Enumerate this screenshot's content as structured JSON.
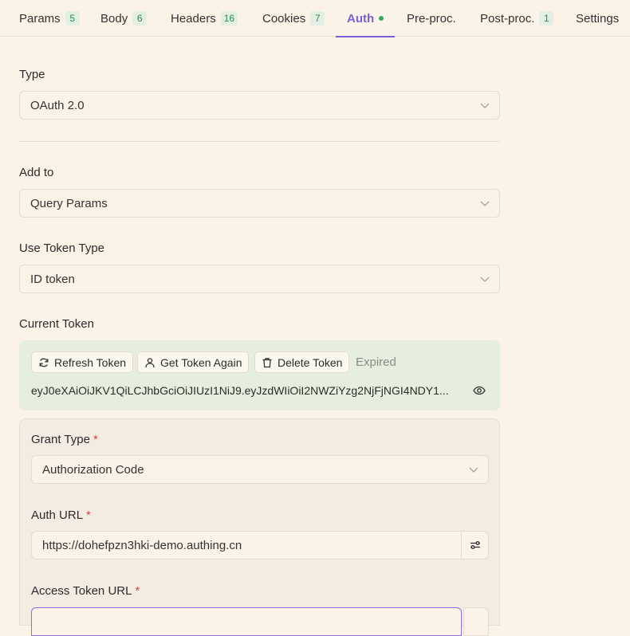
{
  "tabs": [
    {
      "label": "Params",
      "badge": "5"
    },
    {
      "label": "Body",
      "badge": "6"
    },
    {
      "label": "Headers",
      "badge": "16"
    },
    {
      "label": "Cookies",
      "badge": "7"
    },
    {
      "label": "Auth",
      "badge": ""
    },
    {
      "label": "Pre-proc.",
      "badge": ""
    },
    {
      "label": "Post-proc.",
      "badge": "1"
    },
    {
      "label": "Settings",
      "badge": ""
    }
  ],
  "active_tab": "Auth",
  "auth": {
    "type_label": "Type",
    "type_value": "OAuth 2.0",
    "add_to_label": "Add to",
    "add_to_value": "Query Params",
    "token_type_label": "Use Token Type",
    "token_type_value": "ID token",
    "current_token_label": "Current Token",
    "refresh_label": "Refresh Token",
    "get_again_label": "Get Token Again",
    "delete_label": "Delete Token",
    "status": "Expired",
    "token_value": "eyJ0eXAiOiJKV1QiLCJhbGciOiJIUzI1NiJ9.eyJzdWIiOiI2NWZiYzg2NjFjNGI4NDY1...",
    "grant_type_label": "Grant Type",
    "grant_type_value": "Authorization Code",
    "auth_url_label": "Auth URL",
    "auth_url_value": "https://dohefpzn3hki-demo.authing.cn",
    "access_token_url_label": "Access Token URL",
    "required_mark": "*"
  },
  "colors": {
    "accent": "#7c5cdb",
    "badge_text": "#2f8a54",
    "required": "#d24343",
    "token_panel_bg": "#e6efdd"
  }
}
